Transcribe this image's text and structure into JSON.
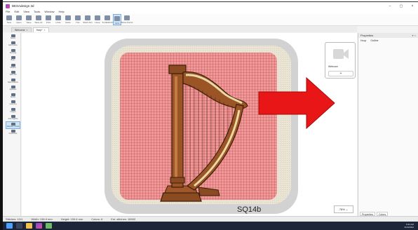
{
  "app": {
    "title": "BESAdesign 3d",
    "window_controls": [
      "–",
      "▢",
      "×"
    ]
  },
  "menu": [
    "File",
    "Edit",
    "View",
    "Tools",
    "Window",
    "Help"
  ],
  "ribbon": [
    {
      "label": "New",
      "icon": "new-file-icon"
    },
    {
      "label": "Open",
      "icon": "open-icon"
    },
    {
      "label": "Save",
      "icon": "save-icon"
    },
    {
      "label": "Save As",
      "icon": "save-as-icon"
    },
    {
      "label": "Print",
      "icon": "print-icon"
    },
    {
      "label": "Undo",
      "icon": "undo-icon"
    },
    {
      "label": "Redo",
      "icon": "redo-icon"
    },
    {
      "label": "Trim",
      "icon": "trim-icon"
    },
    {
      "label": "Stitch Sim",
      "icon": "stitch-icon"
    },
    {
      "label": "Hoop",
      "icon": "hoop-icon"
    },
    {
      "label": "To DESIGN",
      "icon": "design-icon"
    },
    {
      "label": "Grid",
      "icon": "grid-icon"
    },
    {
      "label": "Show Points",
      "icon": "points-icon"
    }
  ],
  "tabs": [
    {
      "label": "Welcome"
    },
    {
      "label": "Harp*"
    }
  ],
  "toolbox": [
    {
      "label": "Select",
      "icon": "select-icon"
    },
    {
      "label": "Edit Nodes",
      "icon": "edit-nodes-icon"
    },
    {
      "label": "Running",
      "icon": "running-icon"
    },
    {
      "label": "Bean",
      "icon": "bean-icon"
    },
    {
      "label": "Shapes",
      "icon": "shapes-icon"
    },
    {
      "label": "Satin Fill",
      "icon": "satin-fill-icon"
    },
    {
      "label": "Satin Column",
      "icon": "satin-column-icon"
    },
    {
      "label": "Applique",
      "icon": "applique-icon"
    },
    {
      "label": "Motifs",
      "icon": "motifs-icon"
    },
    {
      "label": "Lettering",
      "icon": "lettering-icon"
    },
    {
      "label": "Images",
      "icon": "images-icon"
    },
    {
      "label": "Auto Digitize",
      "icon": "auto-digitize-icon"
    },
    {
      "label": "Machine / Hoop",
      "icon": "hoop-icon"
    },
    {
      "label": "Customize",
      "icon": "customize-icon"
    }
  ],
  "canvas": {
    "design_label": "SQ14b",
    "zoom": "78% ⌄"
  },
  "preview_card": {
    "label": "Webcam",
    "add_button": "+"
  },
  "properties": {
    "title": "Properties",
    "controls": "▾ ×",
    "row": [
      "Hoop",
      "Outline"
    ],
    "bottom_tabs": [
      "Properties",
      "Colors"
    ]
  },
  "statusbar": [
    "Stitches: 1111",
    "Width: 138.9 mm",
    "Height: 159.6 mm",
    "Colors: 6",
    "Est. stitches: 18900"
  ],
  "taskbar": {
    "time": "9:33 AM",
    "date": "6/10/2022"
  },
  "colors": {
    "accent": "#7aaee6",
    "stitch_area": "#ef9a9a",
    "arrow": "#e81616",
    "taskbar": "#1d2538"
  }
}
